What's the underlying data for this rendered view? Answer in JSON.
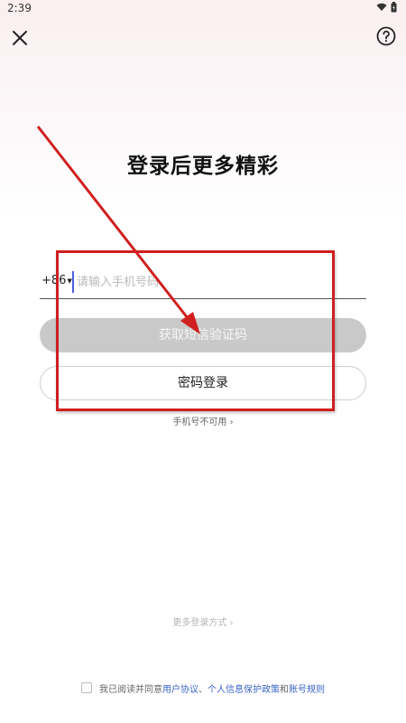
{
  "status_bar": {
    "time": "2:39"
  },
  "icons": {
    "close": "close-icon",
    "help": "help-circle-icon",
    "wifi": "wifi-icon",
    "battery": "battery-icon",
    "caret": "caret-down-icon",
    "chevron": "chevron-right-icon"
  },
  "title": "登录后更多精彩",
  "phone": {
    "country_code": "+86",
    "placeholder": "请输入手机号码",
    "value": ""
  },
  "buttons": {
    "sms_code": "获取短信验证码",
    "password_login": "密码登录"
  },
  "links": {
    "phone_unavailable": "手机号不可用",
    "more_login": "更多登录方式"
  },
  "agreement": {
    "prefix": "我已阅读并同意",
    "user_agreement": "用户协议",
    "separator": "、",
    "privacy_policy": "个人信息保护政策",
    "and": "和",
    "account_rules": "账号规则",
    "checked": false
  },
  "annotation": {
    "color": "#d01f1f"
  }
}
